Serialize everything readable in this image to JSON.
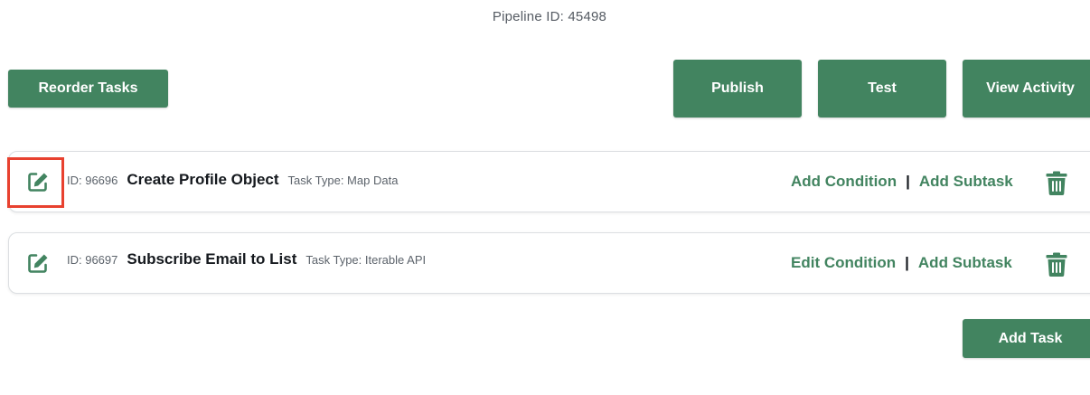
{
  "pipeline": {
    "id_label": "Pipeline ID: 45498"
  },
  "toolbar": {
    "reorder_label": "Reorder Tasks",
    "publish_label": "Publish",
    "test_label": "Test",
    "view_activity_label": "View Activity",
    "add_task_label": "Add Task"
  },
  "tasks": [
    {
      "id_label": "ID: 96696",
      "name": "Create Profile Object",
      "type_label": "Task Type: Map Data",
      "condition_label": "Add Condition",
      "separator": "|",
      "subtask_label": "Add Subtask"
    },
    {
      "id_label": "ID: 96697",
      "name": "Subscribe Email to List",
      "type_label": "Task Type: Iterable API",
      "condition_label": "Edit Condition",
      "separator": "|",
      "subtask_label": "Add Subtask"
    }
  ],
  "icons": {
    "edit": "edit-icon",
    "trash": "trash-icon"
  },
  "colors": {
    "primary_green": "#428460",
    "highlight_red": "#e8412f",
    "text_dark": "#15191e",
    "text_muted": "#5c636b"
  }
}
